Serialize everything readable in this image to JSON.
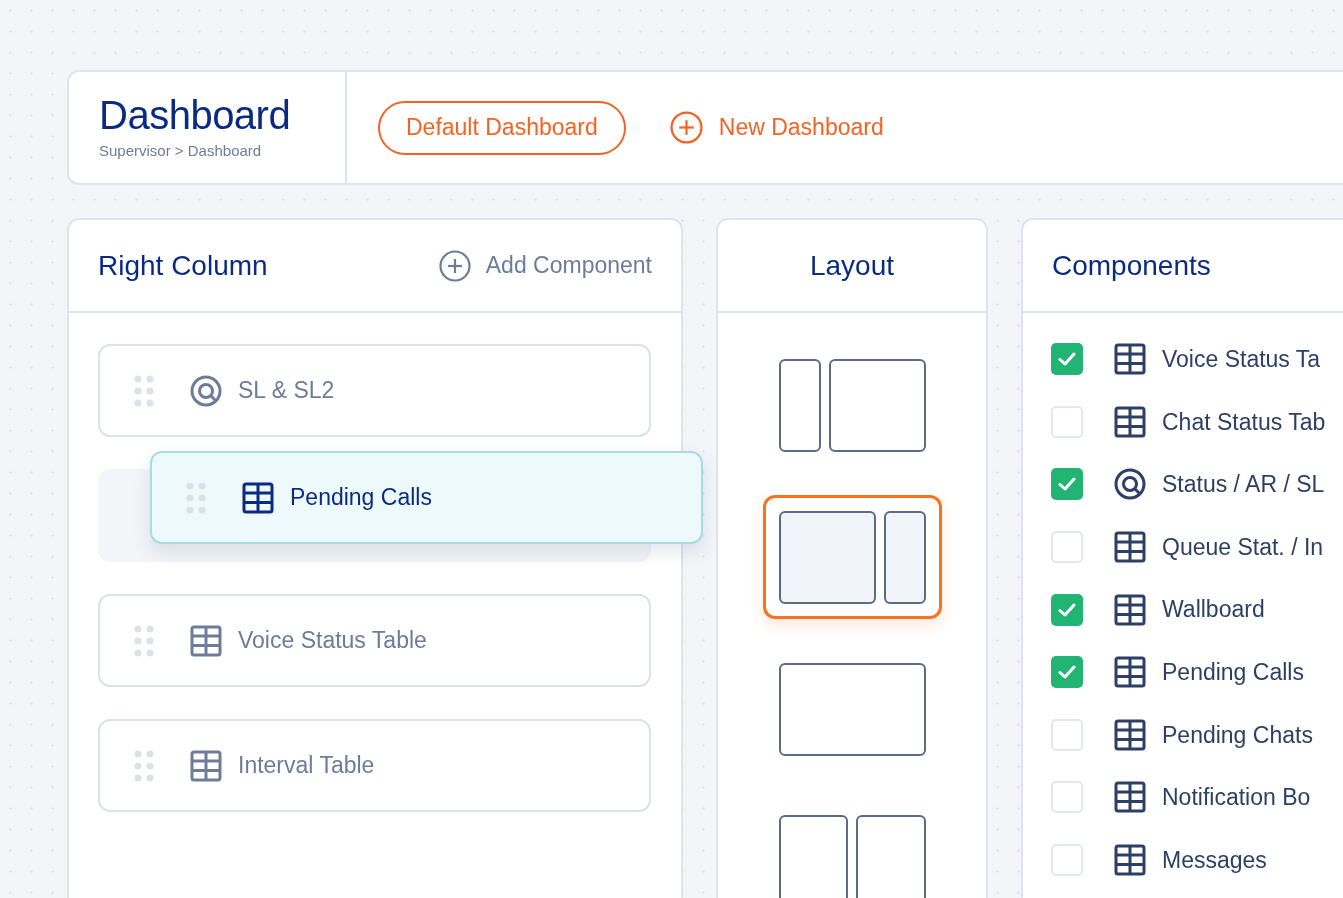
{
  "header": {
    "title": "Dashboard",
    "breadcrumb": "Supervisor > Dashboard",
    "default_button": "Default Dashboard",
    "new_button": "New Dashboard"
  },
  "right_column": {
    "title": "Right Column",
    "add_button": "Add Component",
    "items": [
      {
        "label": "SL & SL2",
        "kind": "target",
        "dragging": false
      },
      {
        "label": "Pending Calls",
        "kind": "table",
        "dragging": true
      },
      {
        "label": "Voice Status Table",
        "kind": "table",
        "dragging": false
      },
      {
        "label": "Interval Table",
        "kind": "table",
        "dragging": false
      }
    ]
  },
  "layout": {
    "title": "Layout",
    "options": [
      {
        "kind": "narrow-wide",
        "selected": false
      },
      {
        "kind": "wide-narrow",
        "selected": true
      },
      {
        "kind": "single",
        "selected": false
      },
      {
        "kind": "two-equal",
        "selected": false
      }
    ]
  },
  "components": {
    "title": "Components",
    "items": [
      {
        "label": "Voice Status Ta",
        "kind": "table",
        "checked": true
      },
      {
        "label": "Chat Status Tab",
        "kind": "table",
        "checked": false
      },
      {
        "label": "Status / AR / SL",
        "kind": "target",
        "checked": true
      },
      {
        "label": "Queue Stat. / In",
        "kind": "table",
        "checked": false
      },
      {
        "label": "Wallboard",
        "kind": "table",
        "checked": true
      },
      {
        "label": "Pending Calls",
        "kind": "table",
        "checked": true
      },
      {
        "label": "Pending Chats",
        "kind": "table",
        "checked": false
      },
      {
        "label": "Notification Bo",
        "kind": "table",
        "checked": false
      },
      {
        "label": "Messages",
        "kind": "table",
        "checked": false
      }
    ]
  }
}
